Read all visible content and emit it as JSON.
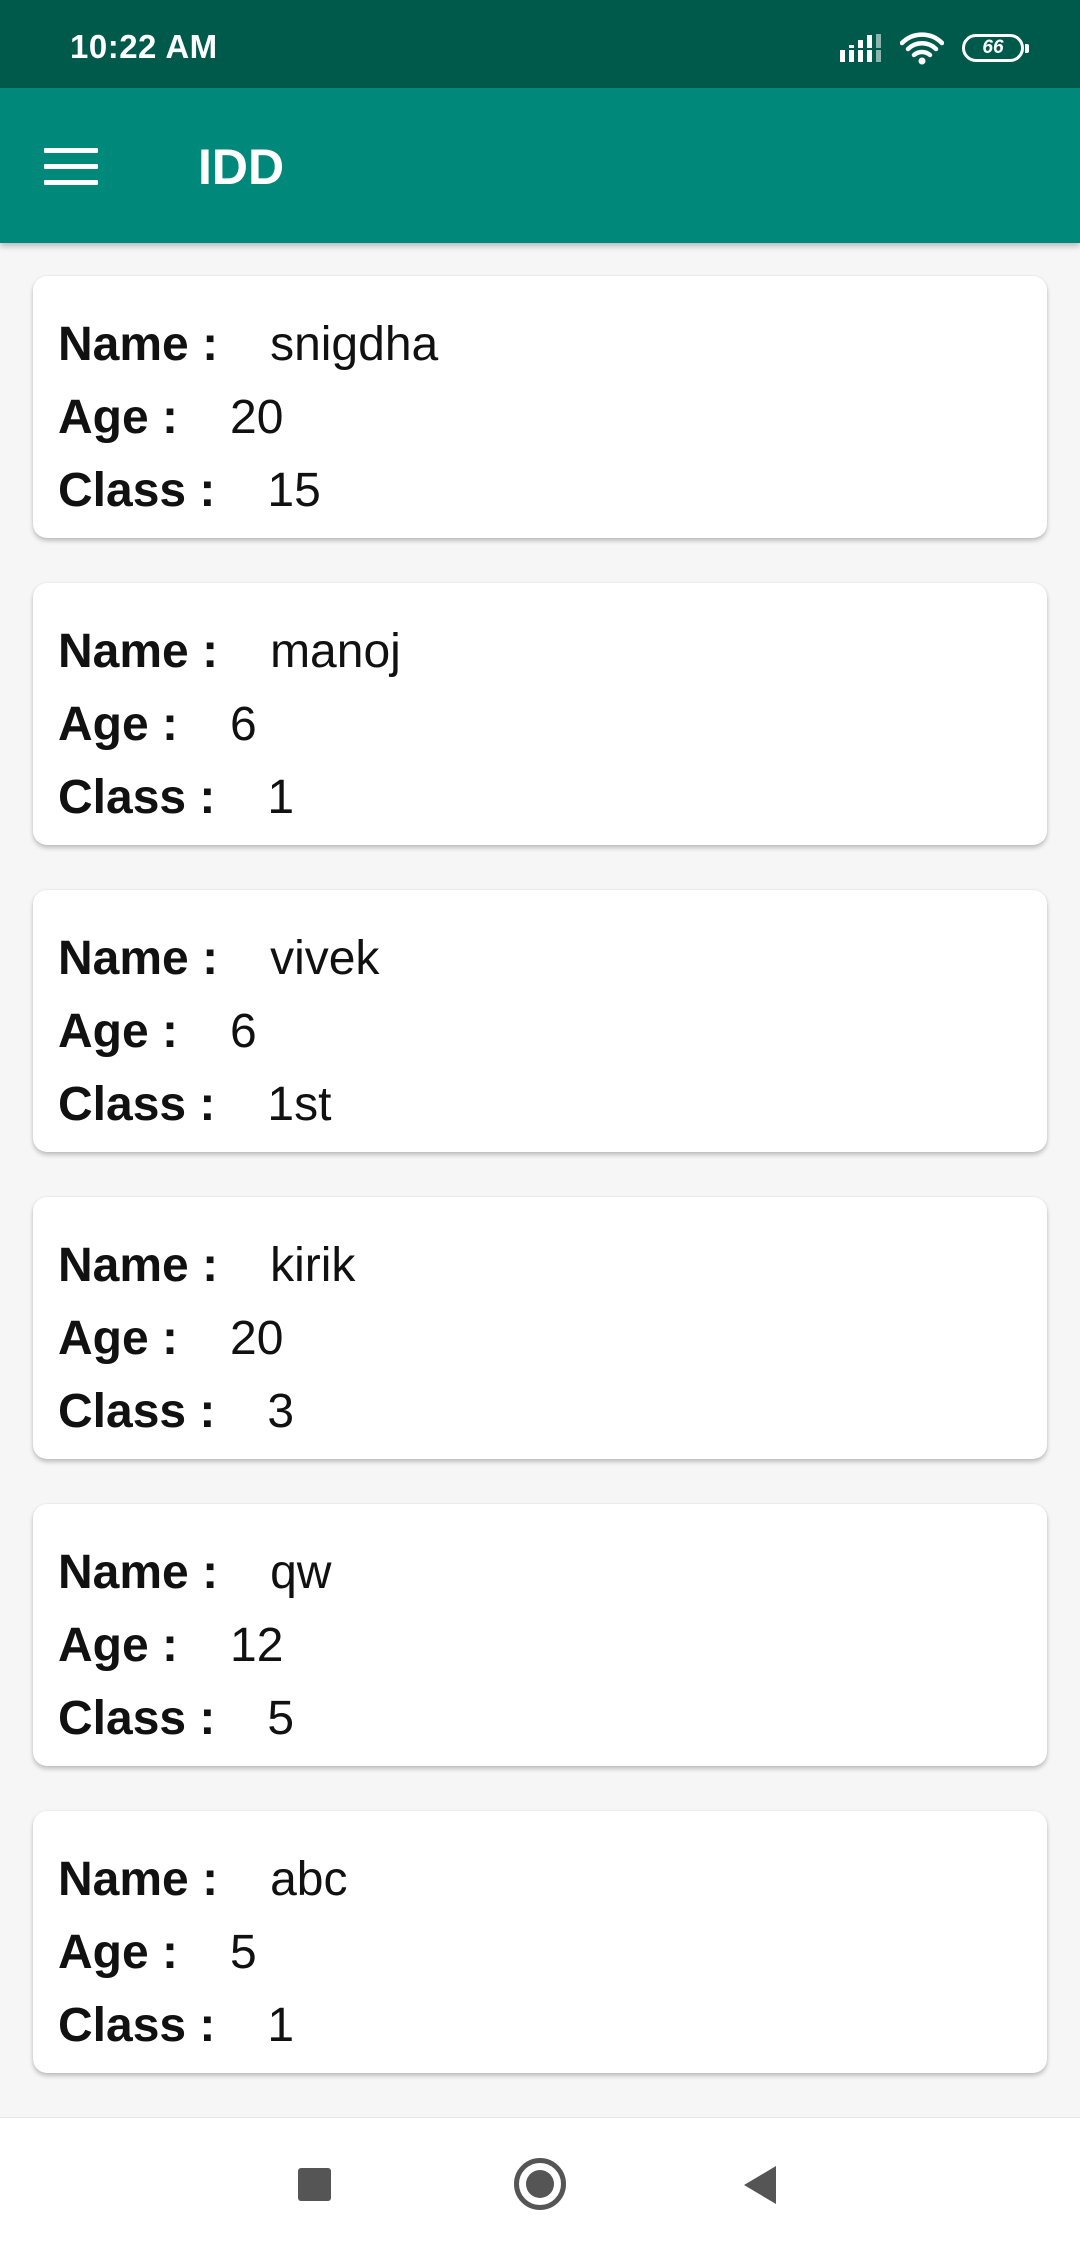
{
  "status_bar": {
    "time": "10:22 AM",
    "battery": "66",
    "icons": [
      "signal-icon",
      "wifi-icon",
      "battery-icon"
    ]
  },
  "app_bar": {
    "title": "IDD",
    "menu_icon": "hamburger-menu-icon"
  },
  "labels": {
    "name": "Name :",
    "age": "Age :",
    "class": "Class :"
  },
  "students": [
    {
      "name": "snigdha",
      "age": "20",
      "class": "15"
    },
    {
      "name": "manoj",
      "age": "6",
      "class": "1"
    },
    {
      "name": "vivek",
      "age": "6",
      "class": "1st"
    },
    {
      "name": "kirik",
      "age": "20",
      "class": "3"
    },
    {
      "name": "qw",
      "age": "12",
      "class": "5"
    },
    {
      "name": "abc",
      "age": "5",
      "class": "1"
    }
  ],
  "nav_bar": {
    "icons": [
      "recents-icon",
      "home-icon",
      "back-icon"
    ]
  },
  "colors": {
    "status_bar": "#005a4c",
    "app_bar": "#00897b",
    "background": "#f6f6f6",
    "card": "#ffffff"
  }
}
